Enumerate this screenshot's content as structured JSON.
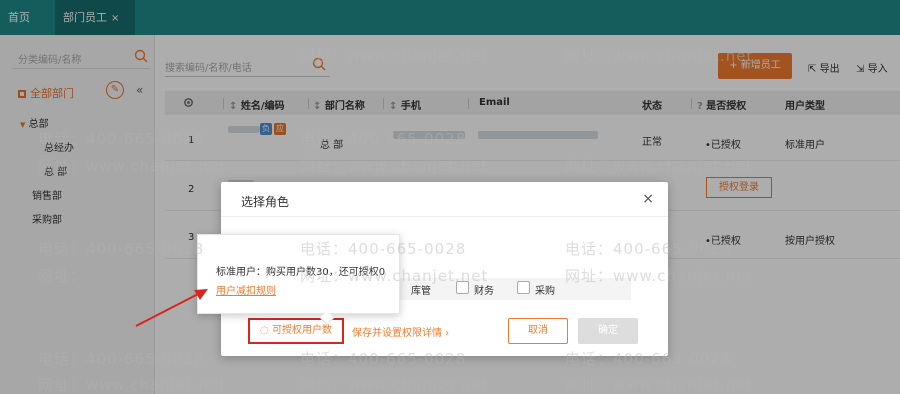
{
  "tabs": {
    "home": "首页",
    "dept_staff": "部门员工",
    "close": "×"
  },
  "sidebar": {
    "search_placeholder": "分类编码/名称",
    "all_depts": "全部部门",
    "edit_icon_glyph": "✎",
    "collapse_glyph": "«",
    "tree": {
      "root": "总部",
      "root_caret": "▼",
      "children": [
        "总经办",
        "总 部"
      ],
      "sales": "销售部",
      "purchase": "采购部"
    }
  },
  "main": {
    "search_placeholder": "搜索编码/名称/电话",
    "add_button": "+ 新增员工",
    "export_button": "导出",
    "import_button": "导入"
  },
  "table": {
    "headers": {
      "name_code": "姓名/编码",
      "dept_name": "部门名称",
      "phone": "手机",
      "email": "Email",
      "status": "状态",
      "authorized": "是否授权",
      "user_type": "用户类型"
    },
    "rows": [
      {
        "no": "1",
        "dept": "总 部",
        "status": "正常",
        "auth": "•已授权",
        "user_type": "标准用户",
        "badge1": "负",
        "badge2": "应"
      },
      {
        "no": "2",
        "auth_button": "授权登录"
      },
      {
        "no": "3",
        "auth": "•已授权",
        "user_type": "按用户授权"
      }
    ]
  },
  "dialog": {
    "title": "选择角色",
    "close": "×",
    "roles": [
      "库管",
      "财务",
      "采购"
    ],
    "authorize_count_link": "可授权用户数",
    "save_link": "保存并设置权限详情 ›",
    "cancel": "取消",
    "ok": "确定"
  },
  "popover": {
    "text": "标准用户：购买用户数30，还可授权0",
    "link": "用户减扣规则"
  },
  "watermarks": {
    "phone": "电话：400-665-0028",
    "site": "网址：www.chanjet.net",
    "site_short": "www.chanjet.net",
    "phone_short": "400-665-0028",
    "site_label": "网址：",
    "phone_label": "电话："
  },
  "colors": {
    "topbar": "#1f8a8a",
    "accent": "#f07b2e",
    "highlight_box": "#d9261c"
  }
}
